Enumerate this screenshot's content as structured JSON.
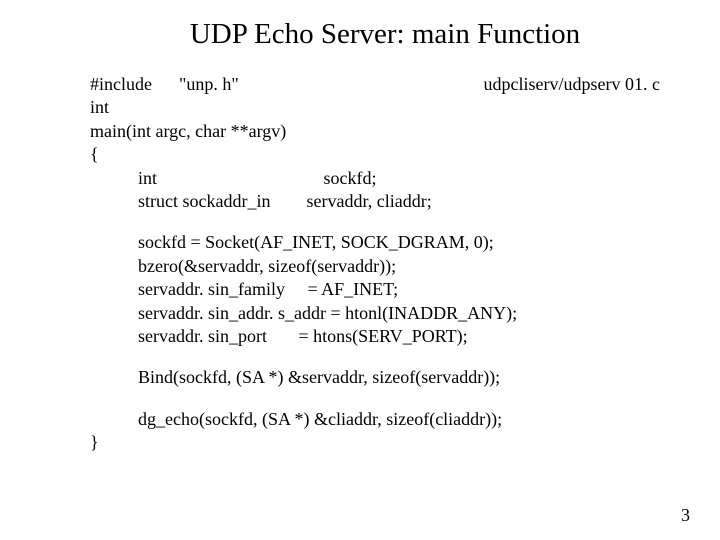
{
  "title": "UDP Echo Server: main Function",
  "file_label": "udpcliserv/udpserv 01. c",
  "code": {
    "l1a": "#include      \"unp. h\"",
    "l2": "int",
    "l3": "main(int argc, char **argv)",
    "l4": "{",
    "l5": "int                                     sockfd;",
    "l6": "struct sockaddr_in        servaddr, cliaddr;",
    "l7": "sockfd = Socket(AF_INET, SOCK_DGRAM, 0);",
    "l8": "bzero(&servaddr, sizeof(servaddr));",
    "l9": "servaddr. sin_family     = AF_INET;",
    "l10": "servaddr. sin_addr. s_addr = htonl(INADDR_ANY);",
    "l11": "servaddr. sin_port       = htons(SERV_PORT);",
    "l12": "Bind(sockfd, (SA *) &servaddr, sizeof(servaddr));",
    "l13": "dg_echo(sockfd, (SA *) &cliaddr, sizeof(cliaddr));",
    "l14": "}"
  },
  "page_number": "3"
}
